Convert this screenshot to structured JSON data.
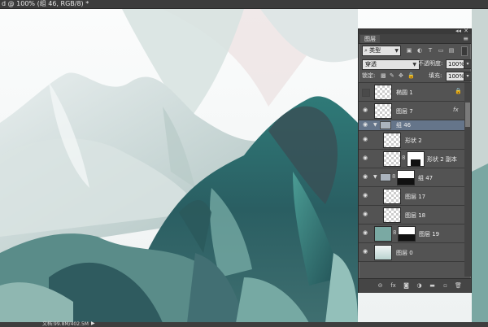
{
  "window": {
    "title": "d @ 100% (组 46, RGB/8) *"
  },
  "status": {
    "doc_text": "文档:99.8M/402.5M",
    "arrow": "▶"
  },
  "panel": {
    "tab_label": "图层",
    "collapse_glyph": "◂◂",
    "close_glyph": "✕",
    "menu_glyph": "≡",
    "filter": {
      "kind_label": "类型",
      "search_glyph": "⌕",
      "icons": [
        "pixel-filter-icon",
        "adjustment-filter-icon",
        "type-filter-icon",
        "shape-filter-icon",
        "smartobject-filter-icon"
      ],
      "icon_glyphs": [
        "▣",
        "◐",
        "T",
        "▭",
        "▤"
      ]
    },
    "blend_mode": "穿透",
    "opacity_label": "不透明度:",
    "opacity_value": "100%",
    "lock_label": "锁定:",
    "fill_label": "填充:",
    "fill_value": "100%",
    "lock_glyphs": [
      "▩",
      "✎",
      "✥",
      "🔒"
    ],
    "layers": [
      {
        "name": "椭圆 1",
        "visible": false,
        "locked": true
      },
      {
        "name": "图层 7",
        "visible": true,
        "fx": "fx"
      },
      {
        "name": "组 46",
        "visible": true,
        "group": true,
        "selected": true
      },
      {
        "name": "形状 2",
        "visible": true
      },
      {
        "name": "形状 2 副本",
        "visible": true,
        "mask": true
      },
      {
        "name": "组 47",
        "visible": true,
        "group": true,
        "mask": true
      },
      {
        "name": "图层 17",
        "visible": true
      },
      {
        "name": "图层 18",
        "visible": true
      },
      {
        "name": "图层 19",
        "visible": true,
        "mask": true
      },
      {
        "name": "图层 0",
        "visible": true
      }
    ],
    "bottom_icons": [
      "link-layers-icon",
      "fx-icon",
      "add-mask-icon",
      "adjustment-icon",
      "new-group-icon",
      "new-layer-icon",
      "delete-layer-icon"
    ],
    "bottom_glyphs": [
      "⊝",
      "fx",
      "◙",
      "◑",
      "▬",
      "▫",
      "🗑"
    ]
  },
  "colors": {
    "selected_row": "#65758a",
    "panel_bg": "#535353"
  }
}
